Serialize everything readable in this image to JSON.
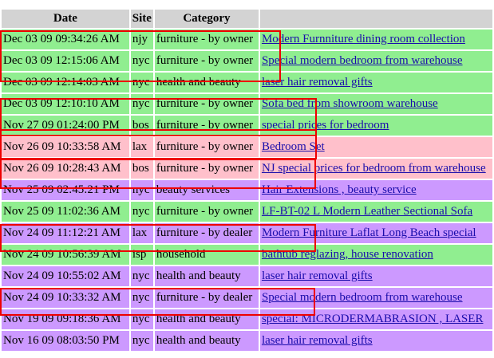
{
  "columns": [
    "Date",
    "Site",
    "Category",
    ""
  ],
  "colors": {
    "green": "#90ee90",
    "pink": "#ffc0cb",
    "purple": "#cc99ff",
    "header": "#d3d3d3",
    "highlight": "#ee0000",
    "link": "#1a0dab"
  },
  "rows": [
    {
      "date": "Dec 03 09 09:34:26 AM",
      "site": "njy",
      "category": "furniture - by owner",
      "title": "Modern Furnniture dining room collection",
      "color": "green",
      "highlighted": true
    },
    {
      "date": "Dec 03 09 12:15:06 AM",
      "site": "nyc",
      "category": "furniture - by owner",
      "title": "Special modern bedroom from warehouse",
      "color": "green",
      "highlighted": true
    },
    {
      "date": "Dec 03 09 12:14:03 AM",
      "site": "nyc",
      "category": "health and beauty",
      "title": "laser hair removal gifts",
      "color": "green",
      "highlighted": false
    },
    {
      "date": "Dec 03 09 12:10:10 AM",
      "site": "nyc",
      "category": "furniture - by owner",
      "title": "Sofa bed from showroom warehouse",
      "color": "green",
      "highlighted": true
    },
    {
      "date": "Nov 27 09 01:24:00 PM",
      "site": "bos",
      "category": "furniture - by owner",
      "title": "special prices for bedroom",
      "color": "green",
      "highlighted": true
    },
    {
      "date": "Nov 26 09 10:33:58 AM",
      "site": "lax",
      "category": "furniture - by owner",
      "title": "Bedroom Set",
      "color": "pink",
      "highlighted": true
    },
    {
      "date": "Nov 26 09 10:28:43 AM",
      "site": "bos",
      "category": "furniture - by owner",
      "title": "NJ special prices for bedroom  from warehouse",
      "color": "pink",
      "highlighted": true
    },
    {
      "date": "Nov 25 09 02:45:21 PM",
      "site": "nyc",
      "category": "beauty services",
      "title": "Hair Extensions , beauty service",
      "color": "purple",
      "highlighted": false
    },
    {
      "date": "Nov 25 09 11:02:36 AM",
      "site": "nyc",
      "category": "furniture - by owner",
      "title": "LF-BT-02 L Modern Leather Sectional Sofa",
      "color": "green",
      "highlighted": false
    },
    {
      "date": "Nov 24 09 11:12:21 AM",
      "site": "lax",
      "category": "furniture - by dealer",
      "title": "Modern Furniture Laflat Long Beach special",
      "color": "purple",
      "highlighted": true
    },
    {
      "date": "Nov 24 09 10:56:39 AM",
      "site": "isp",
      "category": "household",
      "title": "bathtub reglazing, house renovation",
      "color": "green",
      "highlighted": false
    },
    {
      "date": "Nov 24 09 10:55:02 AM",
      "site": "nyc",
      "category": "health and beauty",
      "title": "laser hair removal gifts",
      "color": "purple",
      "highlighted": false
    },
    {
      "date": "Nov 24 09 10:33:32 AM",
      "site": "nyc",
      "category": "furniture - by dealer",
      "title": "Special modern bedroom from warehouse",
      "color": "purple",
      "highlighted": true
    },
    {
      "date": "Nov 19 09 09:18:36 AM",
      "site": "nyc",
      "category": "health and beauty",
      "title": "special: MICRODERMABRASION , LASER",
      "color": "purple",
      "highlighted": false
    },
    {
      "date": "Nov 16 09 08:03:50 PM",
      "site": "nyc",
      "category": "health and beauty",
      "title": "laser hair removal gifts",
      "color": "purple",
      "highlighted": false
    }
  ]
}
